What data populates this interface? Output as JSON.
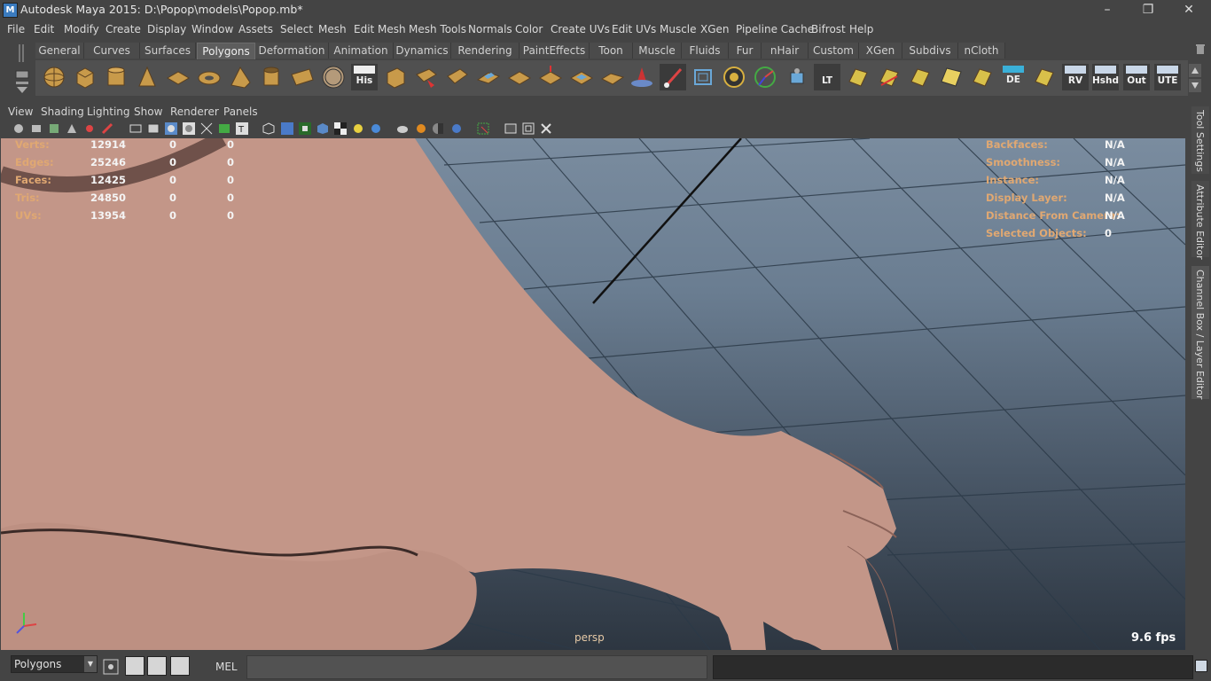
{
  "window": {
    "title": "Autodesk Maya 2015: D:\\Popop\\models\\Popop.mb*",
    "app_icon_letter": "M",
    "controls": [
      "–",
      "❐",
      "✕"
    ]
  },
  "menubar": {
    "items": [
      "File",
      "Edit",
      "Modify",
      "Create",
      "Display",
      "Window",
      "Assets",
      "Select",
      "Mesh",
      "Edit Mesh",
      "Mesh Tools",
      "Normals",
      "Color",
      "Create UVs",
      "Edit UVs",
      "Muscle",
      "XGen",
      "Pipeline Cache",
      "Bifrost",
      "Help"
    ]
  },
  "shelf": {
    "tabs": [
      "General",
      "Curves",
      "Surfaces",
      "Polygons",
      "Deformation",
      "Animation",
      "Dynamics",
      "Rendering",
      "PaintEffects",
      "Toon",
      "Muscle",
      "Fluids",
      "Fur",
      "nHair",
      "Custom",
      "XGen",
      "Subdivs",
      "nCloth"
    ],
    "active_tab": "Polygons",
    "text_tools": [
      "His",
      "LT",
      "DE",
      "RV",
      "Hshd",
      "Out",
      "UTE"
    ]
  },
  "panel": {
    "menus": [
      "View",
      "Shading",
      "Lighting",
      "Show",
      "Renderer",
      "Panels"
    ]
  },
  "hud": {
    "left_rows": [
      {
        "label": "Verts:",
        "total": "12914",
        "sel": "0",
        "comp": "0"
      },
      {
        "label": "Edges:",
        "total": "25246",
        "sel": "0",
        "comp": "0"
      },
      {
        "label": "Faces:",
        "total": "12425",
        "sel": "0",
        "comp": "0"
      },
      {
        "label": "Tris:",
        "total": "24850",
        "sel": "0",
        "comp": "0"
      },
      {
        "label": "UVs:",
        "total": "13954",
        "sel": "0",
        "comp": "0"
      }
    ],
    "right_rows": [
      {
        "label": "Backfaces:",
        "value": "N/A"
      },
      {
        "label": "Smoothness:",
        "value": "N/A"
      },
      {
        "label": "Instance:",
        "value": "N/A"
      },
      {
        "label": "Display Layer:",
        "value": "N/A"
      },
      {
        "label": "Distance From Camera:",
        "value": "N/A"
      },
      {
        "label": "Selected Objects:",
        "value": "0"
      }
    ],
    "camera": "persp",
    "fps": "9.6 fps"
  },
  "side_tabs": [
    "Tool Settings",
    "Attribute Editor",
    "Channel Box / Layer Editor"
  ],
  "bottom": {
    "mode_value": "Polygons",
    "mel_label": "MEL"
  },
  "colors": {
    "ui_bg": "#444444",
    "hud_label": "#e0a872",
    "skin": "#c9998a",
    "active_tab": "#5d5d5d"
  }
}
